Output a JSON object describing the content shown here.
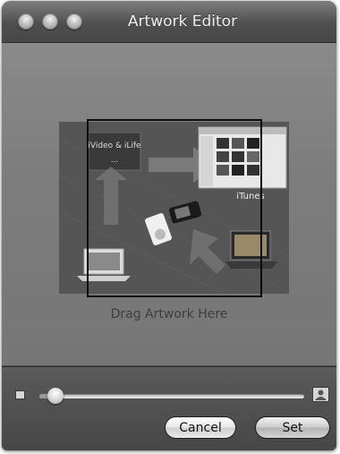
{
  "window": {
    "title": "Artwork Editor"
  },
  "drop_area": {
    "label": "Drag Artwork Here",
    "preview_texts": {
      "top_left_caption": "iVideo & iLife",
      "top_left_sub": "...",
      "itunes_caption": "iTunes"
    }
  },
  "zoom_slider": {
    "value_fraction": 0.06,
    "min_icon": "small-picture-icon",
    "max_icon": "large-picture-icon"
  },
  "buttons": {
    "cancel": "Cancel",
    "set": "Set"
  },
  "colors": {
    "title_text": "#eeeeee",
    "content_bg": "#7d7d7d",
    "crop_frame": "#0c0c0c"
  }
}
